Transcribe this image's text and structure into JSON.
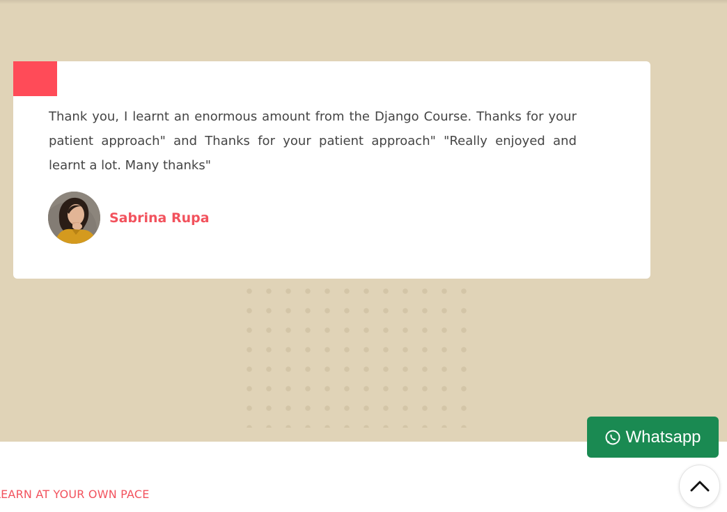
{
  "testimonial": {
    "quote": "Thank you, I learnt an enormous amount from the Django Course. Thanks for your patient approach\" and Thanks for your patient approach\" \"Really enjoyed and learnt a lot. Many thanks\"",
    "author_name": "Sabrina Rupa",
    "avatar_icon": "person-avatar"
  },
  "whatsapp_button": {
    "label": "Whatsapp",
    "icon": "whatsapp-icon"
  },
  "scroll_top": {
    "icon": "chevron-up-icon"
  },
  "next_section": {
    "label": "LEARN AT YOUR OWN PACE"
  },
  "colors": {
    "section_bg": "#e0d3b7",
    "accent": "#ff4b58",
    "name": "#f2525d",
    "whatsapp": "#1a8a52",
    "dots": "#d3c5a7"
  }
}
